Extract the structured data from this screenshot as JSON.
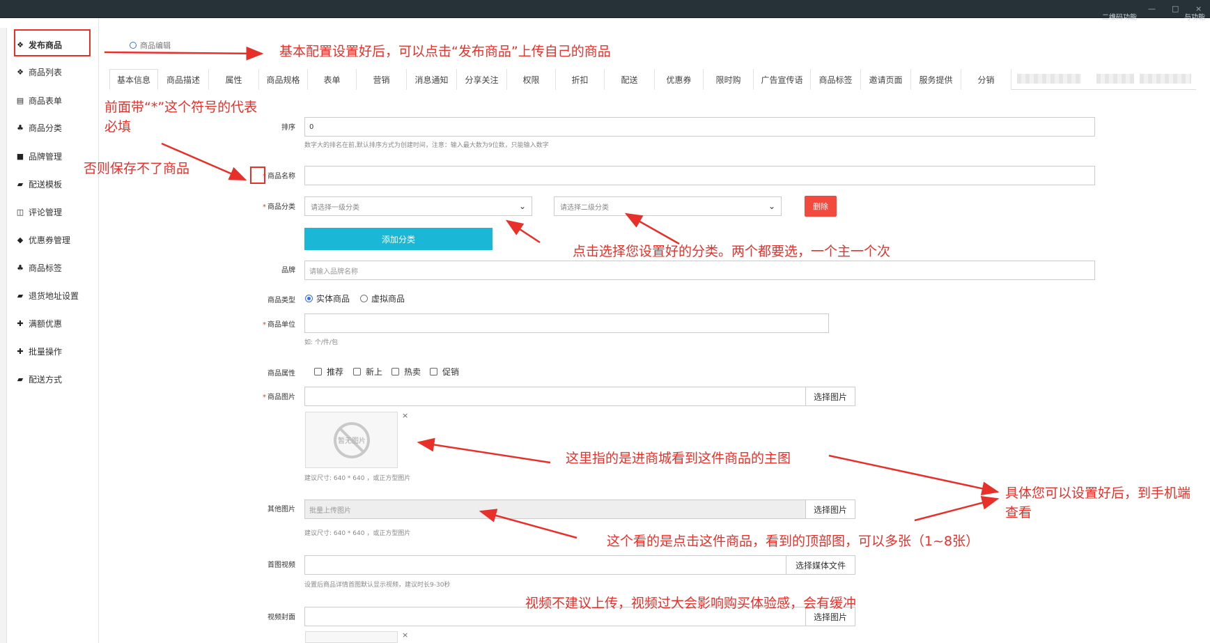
{
  "window": {
    "controls": [
      "—",
      "□",
      "×"
    ],
    "top_note_left": "二维码功能",
    "top_note_right": "与功能"
  },
  "sidebar": {
    "items": [
      {
        "label": "发布商品",
        "icon": "cubes-icon"
      },
      {
        "label": "商品列表",
        "icon": "cubes-icon"
      },
      {
        "label": "商品表单",
        "icon": "file-icon"
      },
      {
        "label": "商品分类",
        "icon": "sitemap-icon"
      },
      {
        "label": "品牌管理",
        "icon": "briefcase-icon"
      },
      {
        "label": "配送模板",
        "icon": "truck-icon"
      },
      {
        "label": "评论管理",
        "icon": "columns-icon"
      },
      {
        "label": "优惠券管理",
        "icon": "tag-icon"
      },
      {
        "label": "商品标签",
        "icon": "sitemap-icon"
      },
      {
        "label": "退货地址设置",
        "icon": "truck-icon"
      },
      {
        "label": "满额优惠",
        "icon": "gift-icon"
      },
      {
        "label": "批量操作",
        "icon": "gift-icon"
      },
      {
        "label": "配送方式",
        "icon": "truck-icon"
      }
    ]
  },
  "breadcrumb": "商品编辑",
  "tabs": [
    "基本信息",
    "商品描述",
    "属性",
    "商品规格",
    "表单",
    "营销",
    "消息通知",
    "分享关注",
    "权限",
    "折扣",
    "配送",
    "优惠券",
    "限时购",
    "广告宣传语",
    "商品标签",
    "邀请页面",
    "服务提供",
    "分销"
  ],
  "form": {
    "sort": {
      "label": "排序",
      "value": "0",
      "help": "数字大的排名在前,默认排序方式为创建时间，注意：输入最大数为9位数，只能输入数字"
    },
    "name": {
      "label": "商品名称",
      "required": "*"
    },
    "category": {
      "label": "商品分类",
      "required": "*",
      "first_placeholder": "请选择一级分类",
      "second_placeholder": "请选择二级分类",
      "delete_label": "删除",
      "add_label": "添加分类"
    },
    "brand": {
      "label": "品牌",
      "placeholder": "请输入品牌名称"
    },
    "type": {
      "label": "商品类型",
      "options": [
        "实体商品",
        "虚拟商品"
      ],
      "selected": "实体商品"
    },
    "unit": {
      "label": "商品单位",
      "required": "*",
      "help": "如: 个/件/包"
    },
    "attrs": {
      "label": "商品属性",
      "options": [
        "推荐",
        "新上",
        "热卖",
        "促销"
      ]
    },
    "main_image": {
      "label": "商品图片",
      "required": "*",
      "button": "选择图片",
      "placeholder_text": "暂无图片",
      "help": "建议尺寸: 640 * 640 ，或正方型图片",
      "close": "×"
    },
    "other_images": {
      "label": "其他图片",
      "placeholder": "批量上传图片",
      "button": "选择图片",
      "help": "建议尺寸: 640 * 640 ，或正方型图片"
    },
    "video": {
      "label": "首图视频",
      "button": "选择媒体文件",
      "help": "设置后商品详情首图默认显示视频，建议时长9-30秒"
    },
    "cover": {
      "label": "视频封面",
      "button": "选择图片",
      "close": "×"
    }
  },
  "annotations": {
    "a1": "基本配置设置好后，可以点击“发布商品”上传自己的商品",
    "a2": "前面带“*”这个符号的代表必填",
    "a3": "否则保存不了商品",
    "a4": "点击选择您设置好的分类。两个都要选，一个主一个次",
    "a5": "这里指的是进商城看到这件商品的主图",
    "a6": "具体您可以设置好后，到手机端查看",
    "a7": "这个看的是点击这件商品，看到的顶部图，可以多张（1~8张）",
    "a8": "视频不建议上传，视频过大会影响购买体验感，会有缓冲"
  },
  "colors": {
    "annotation": "#e8302a",
    "add_button": "#1ab8d6",
    "delete_button": "#f34a3f",
    "topbar": "#263238"
  }
}
